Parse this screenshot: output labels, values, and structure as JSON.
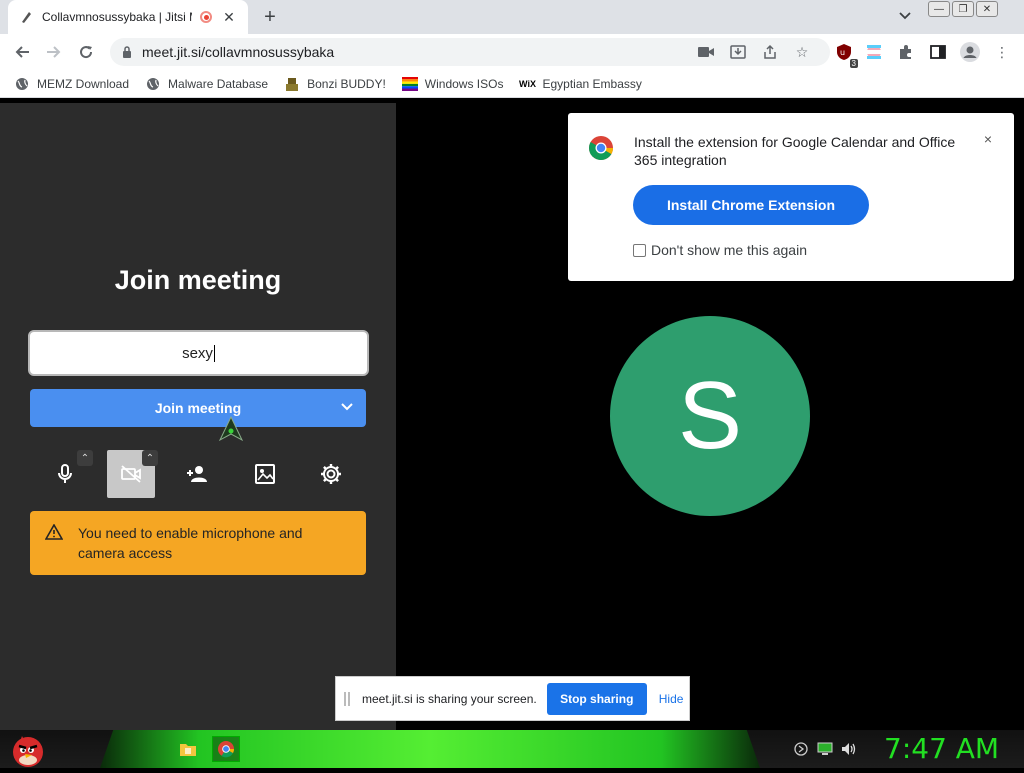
{
  "browser": {
    "tab_title": "Collavmnosussybaka | Jitsi M",
    "url": "meet.jit.si/collavmnosussybaka",
    "bookmarks": [
      {
        "label": "MEMZ Download",
        "icon": "globe-icon"
      },
      {
        "label": "Malware Database",
        "icon": "globe-icon"
      },
      {
        "label": "Bonzi BUDDY!",
        "icon": "bonzi-icon"
      },
      {
        "label": "Windows ISOs",
        "icon": "windows-flag-icon"
      },
      {
        "label": "Egyptian Embassy",
        "icon": "wix-icon"
      }
    ],
    "extension_badge": "3"
  },
  "prejoin": {
    "title": "Join meeting",
    "name_value": "sexy",
    "join_label": "Join meeting",
    "warning": "You need to enable microphone and camera access"
  },
  "avatar": {
    "initial": "S",
    "color": "#2e9e6e"
  },
  "extension_popup": {
    "text": "Install the extension for Google Calendar and Office 365 integration",
    "button_label": "Install Chrome Extension",
    "checkbox_label": "Don't show me this again"
  },
  "share_bar": {
    "text": "meet.jit.si is sharing your screen.",
    "stop_label": "Stop sharing",
    "hide_label": "Hide"
  },
  "taskbar": {
    "clock": "7:47 AM"
  },
  "colors": {
    "join_button": "#4a8ff0",
    "warning": "#f5a623",
    "install_button": "#1a6ee6",
    "clock": "#22e022"
  }
}
